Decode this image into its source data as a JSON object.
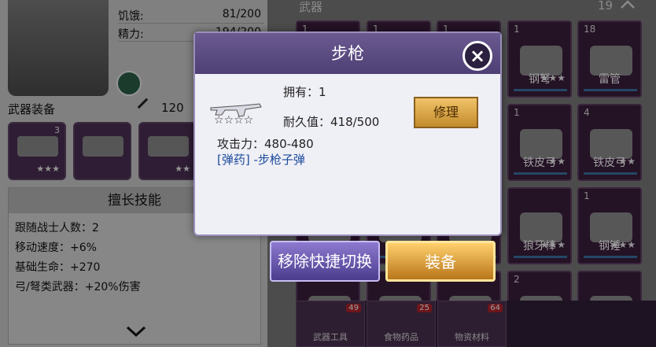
{
  "character": {
    "hunger_label": "饥饿:",
    "hunger_value": "81/200",
    "energy_label": "精力:",
    "energy_value": "194/200"
  },
  "left": {
    "weapon_equip_label": "武器装备",
    "attack_value": "120",
    "equip_slots": [
      {
        "stars": "★★★",
        "badge": "3"
      },
      {
        "stars": "",
        "badge": ""
      },
      {
        "stars": "★★",
        "badge": ""
      }
    ],
    "skills_title": "擅长技能",
    "skills": [
      "跟随战士人数：2",
      "移动速度：+6%",
      "基础生命：+270",
      "弓/弩类武器：+20%伤害"
    ]
  },
  "inventory": {
    "title": "武器",
    "count": "19",
    "items": [
      {
        "name": "",
        "qty": "1",
        "stars": ""
      },
      {
        "name": "",
        "qty": "1",
        "stars": ""
      },
      {
        "name": "",
        "qty": "1",
        "stars": ""
      },
      {
        "name": "钢弩",
        "qty": "1",
        "stars": "★★★"
      },
      {
        "name": "雷管",
        "qty": "18",
        "stars": ""
      },
      {
        "name": "",
        "qty": "",
        "stars": ""
      },
      {
        "name": "",
        "qty": "",
        "stars": ""
      },
      {
        "name": "",
        "qty": "",
        "stars": ""
      },
      {
        "name": "铁皮弓",
        "qty": "1",
        "stars": "★★"
      },
      {
        "name": "铁皮弓",
        "qty": "4",
        "stars": "★★"
      },
      {
        "name": "",
        "qty": "",
        "stars": ""
      },
      {
        "name": "",
        "qty": "",
        "stars": ""
      },
      {
        "name": "",
        "qty": "",
        "stars": ""
      },
      {
        "name": "狼牙棒",
        "qty": "",
        "stars": "★★★"
      },
      {
        "name": "钢锤",
        "qty": "1",
        "stars": "★★★"
      },
      {
        "name": "",
        "qty": "",
        "stars": ""
      },
      {
        "name": "",
        "qty": "",
        "stars": ""
      },
      {
        "name": "",
        "qty": "",
        "stars": ""
      },
      {
        "name": "",
        "qty": "2",
        "stars": ""
      },
      {
        "name": "",
        "qty": "",
        "stars": ""
      }
    ]
  },
  "modal": {
    "title": "步枪",
    "own_label": "拥有：1",
    "durability_label": "耐久值：418/500",
    "attack_label": "攻击力：480-480",
    "ammo_label": "[弹药] -步枪子弹",
    "stars": "☆☆☆☆",
    "repair_label": "修理"
  },
  "buttons": {
    "remove_label": "移除快捷切换",
    "equip_label": "装备"
  },
  "tabs": [
    {
      "label": "武器工具",
      "badge": "49"
    },
    {
      "label": "食物药品",
      "badge": "25"
    },
    {
      "label": "物资材料",
      "badge": "64"
    }
  ]
}
